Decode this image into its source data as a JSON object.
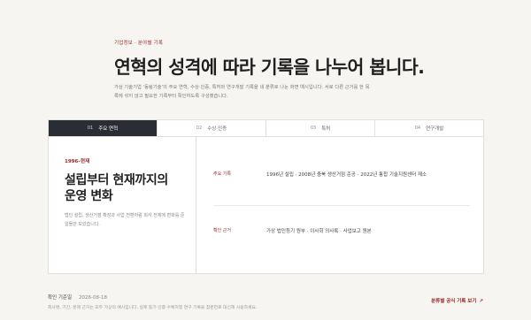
{
  "breadcrumb": "기업정보 · 분야별 기록",
  "headline": "연혁의 성격에 따라 기록을 나누어 봅니다.",
  "lede": "가상 기술기업 '동림기술'의 주요 연혁, 수상·인증, 특허와 연구개발 기록을 네 분류로 나눈 화면 예시입니다. 서로 다른 근거를 한 목록에 섞지 않고 필요한 기록부터 확인하도록 구성했습니다.",
  "tabs": [
    {
      "num": "01",
      "label": "주요 연혁",
      "active": true
    },
    {
      "num": "02",
      "label": "수상·인증",
      "active": false
    },
    {
      "num": "03",
      "label": "특허",
      "active": false
    },
    {
      "num": "04",
      "label": "연구개발",
      "active": false
    }
  ],
  "section": {
    "period": "1996–현재",
    "title_line1": "설립부터 현재까지의",
    "title_line2": "운영 변화",
    "desc": "법인 설립, 생산거점 확장과 사업 전환처럼 회사 전체에 변화를 준 일들만 모았습니다."
  },
  "rows": [
    {
      "key": "주요 기록",
      "value": "1996년 설립 · 2008년 충북 생산거점 준공 · 2022년 통합 기술지원센터 재소"
    },
    {
      "key": "확인 근거",
      "value": "가상 법인등기 원부 · 이사회 의사록 · 사업보고 원본"
    }
  ],
  "footer": {
    "label": "확인 기준일",
    "date": "2026-08-18",
    "note": "회사명, 기간, 문제 근거는 모두 가상의 예시입니다. 실제 등기·인증·수특허청 연구 기록을 참문헌로 대신해 사용하세요.",
    "link": "분류별 공식 기록 보기",
    "link_arrow": "↗"
  },
  "colors": {
    "accent": "#9a2a26",
    "tab_active_bg": "#2a2e34",
    "background": "#f7f5f2"
  }
}
